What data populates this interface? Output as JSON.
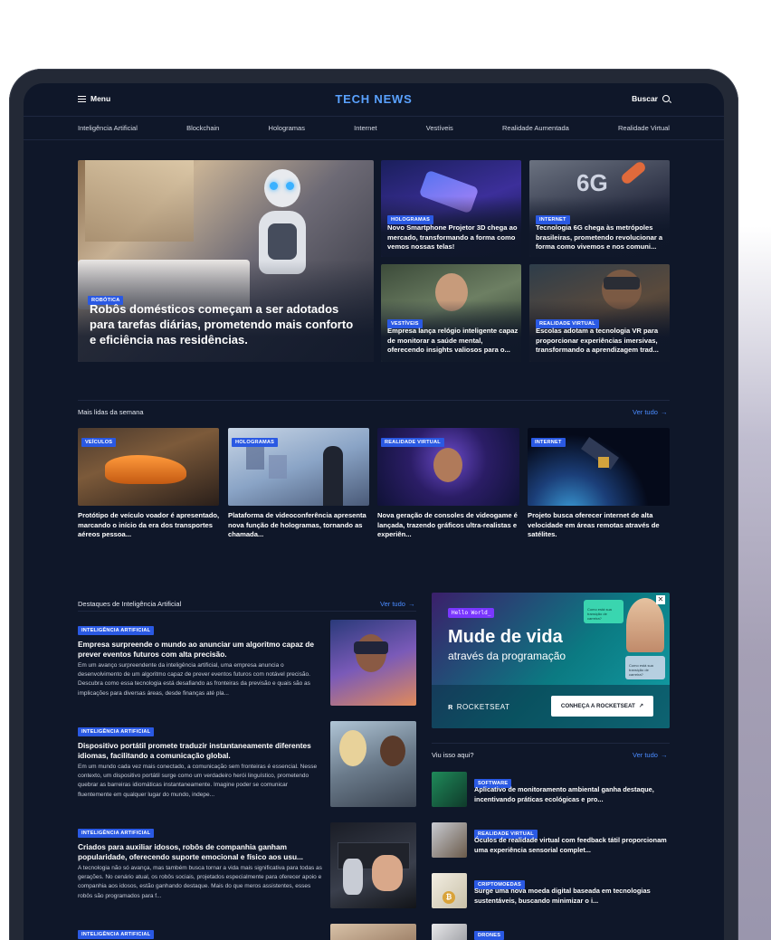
{
  "header": {
    "menu_label": "Menu",
    "logo": "TECH NEWS",
    "search_label": "Buscar"
  },
  "categories": [
    "Inteligência Artificial",
    "Blockchain",
    "Hologramas",
    "Internet",
    "Vestíveis",
    "Realidade Aumentada",
    "Realidade Virtual"
  ],
  "hero": {
    "main": {
      "badge": "ROBÓTICA",
      "title": "Robôs domésticos começam a ser adotados para tarefas diárias, prometendo mais conforto e eficiência nas residências."
    },
    "cards": [
      {
        "badge": "HOLOGRAMAS",
        "title": "Novo Smartphone Projetor 3D chega ao mercado, transformando a forma como vemos nossas telas!"
      },
      {
        "badge": "INTERNET",
        "title": "Tecnologia 6G chega às metrópoles brasileiras, prometendo revolucionar a forma como vivemos e nos comuni..."
      },
      {
        "badge": "VESTÍVEIS",
        "title": "Empresa lança relógio inteligente capaz de monitorar a saúde mental, oferecendo insights valiosos para o..."
      },
      {
        "badge": "REALIDADE VIRTUAL",
        "title": "Escolas adotam a tecnologia VR para proporcionar experiências imersivas, transformando a aprendizagem trad..."
      }
    ]
  },
  "most_read": {
    "title": "Mais lidas da semana",
    "see_all": "Ver tudo",
    "items": [
      {
        "badge": "VEÍCULOS",
        "title": "Protótipo de veículo voador é apresentado, marcando o início da era dos transportes aéreos pessoa..."
      },
      {
        "badge": "HOLOGRAMAS",
        "title": "Plataforma de videoconferência apresenta nova função de hologramas, tornando as chamada..."
      },
      {
        "badge": "REALIDADE VIRTUAL",
        "title": "Nova geração de consoles de videogame é lançada, trazendo gráficos ultra-realistas e experiên..."
      },
      {
        "badge": "INTERNET",
        "title": "Projeto busca oferecer internet de alta velocidade em áreas remotas através de satélites."
      }
    ]
  },
  "ai_section": {
    "title": "Destaques de Inteligência Artificial",
    "see_all": "Ver tudo",
    "items": [
      {
        "badge": "INTELIGÊNCIA ARTIFICIAL",
        "title": "Empresa surpreende o mundo ao anunciar um algoritmo capaz de prever eventos futuros com alta precisão.",
        "text": "Em um avanço surpreendente da inteligência artificial, uma empresa anuncia o desenvolvimento de um algoritmo capaz de prever eventos futuros com notável precisão. Descubra como essa tecnologia está desafiando as fronteiras da previsão e quais são as implicações para diversas áreas, desde finanças até pla..."
      },
      {
        "badge": "INTELIGÊNCIA ARTIFICIAL",
        "title": "Dispositivo portátil promete traduzir instantaneamente diferentes idiomas, facilitando a comunicação global.",
        "text": "Em um mundo cada vez mais conectado, a comunicação sem fronteiras é essencial. Nesse contexto, um dispositivo portátil surge como um verdadeiro herói linguístico, prometendo quebrar as barreiras idiomáticas instantaneamente. Imagine poder se comunicar fluentemente em qualquer lugar do mundo, indepe..."
      },
      {
        "badge": "INTELIGÊNCIA ARTIFICIAL",
        "title": "Criados para auxiliar idosos, robôs de companhia ganham popularidade, oferecendo suporte emocional e físico aos usu...",
        "text": "A tecnologia não só avança, mas também busca tornar a vida mais significativa para todas as gerações. No cenário atual, os robôs sociais, projetados especialmente para oferecer apoio e companhia aos idosos, estão ganhando destaque. Mais do que meros assistentes, esses robôs são programados para f..."
      },
      {
        "badge": "INTELIGÊNCIA ARTIFICIAL",
        "title": "",
        "text": ""
      }
    ]
  },
  "ad": {
    "hello": "Hello World_",
    "headline": "Mude de vida",
    "subline": "através da programação",
    "brand": "ROCKETSEAT",
    "cta": "CONHEÇA A ROCKETSEAT",
    "bubble1": "Como está sua transição de carreira?",
    "bubble2": "Como está sua transição de carreira?"
  },
  "seen": {
    "title": "Viu isso aqui?",
    "see_all": "Ver tudo",
    "items": [
      {
        "badge": "SOFTWARE",
        "title": "Aplicativo de monitoramento ambiental ganha destaque, incentivando práticas ecológicas e pro..."
      },
      {
        "badge": "REALIDADE VIRTUAL",
        "title": "Óculos de realidade virtual com feedback tátil proporcionam uma experiência sensorial complet..."
      },
      {
        "badge": "CRIPTOMOEDAS",
        "title": "Surge uma nova moeda digital baseada em tecnologias sustentáveis, buscando minimizar o i..."
      },
      {
        "badge": "DRONES",
        "title": ""
      }
    ]
  },
  "colors": {
    "background": "#0f1729",
    "accent": "#2a59e3",
    "logo": "#5aa2ff",
    "link": "#4a8bff"
  }
}
